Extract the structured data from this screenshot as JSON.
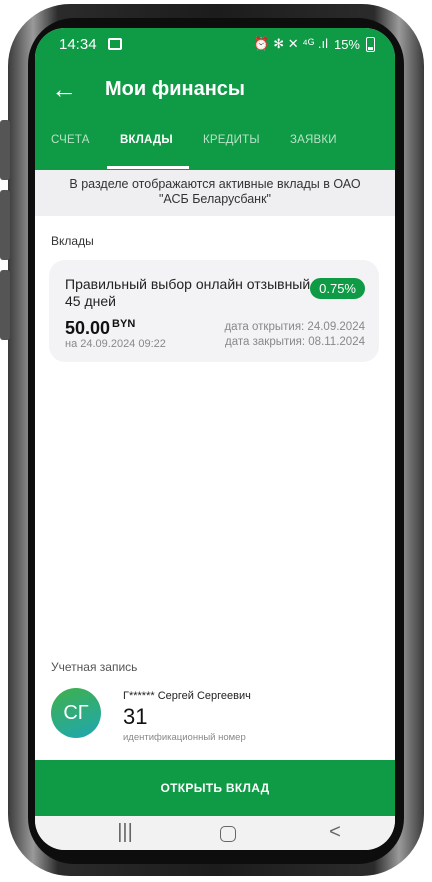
{
  "status_bar": {
    "time": "14:34",
    "right_icons": "⏰ ✻ ✕ ⁴ᴳ .ıl",
    "battery_text": "15%"
  },
  "app_bar": {
    "back_icon": "arrow-left",
    "title": "Мои финансы"
  },
  "tabs": [
    {
      "label": "СЧЕТА",
      "active": false
    },
    {
      "label": "ВКЛАДЫ",
      "active": true
    },
    {
      "label": "КРЕДИТЫ",
      "active": false
    },
    {
      "label": "ЗАЯВКИ",
      "active": false
    }
  ],
  "notice": "В разделе отображаются активные вклады в ОАО \"АСБ Беларусбанк\"",
  "deposits": {
    "section_label": "Вклады",
    "items": [
      {
        "name": "Правильный выбор онлайн отзывный 45 дней",
        "rate": "0.75%",
        "amount": "50.00",
        "currency": "BYN",
        "as_of": "на 24.09.2024 09:22",
        "opened": "дата открытия:  24.09.2024",
        "closes": "дата закрытия:  08.11.2024"
      }
    ]
  },
  "account": {
    "label": "Учетная запись",
    "initials": "СГ",
    "name": "Г****** Сергей Сергеевич",
    "id_number": "31",
    "id_label": "идентификационный номер"
  },
  "open_button": "ОТКРЫТЬ ВКЛАД",
  "nav_bar": {
    "recents": "|||",
    "back": "<"
  },
  "colors": {
    "brand_green": "#0f9a45",
    "avatar_gradient_start": "#3fb04a",
    "avatar_gradient_end": "#1fa7b3"
  }
}
